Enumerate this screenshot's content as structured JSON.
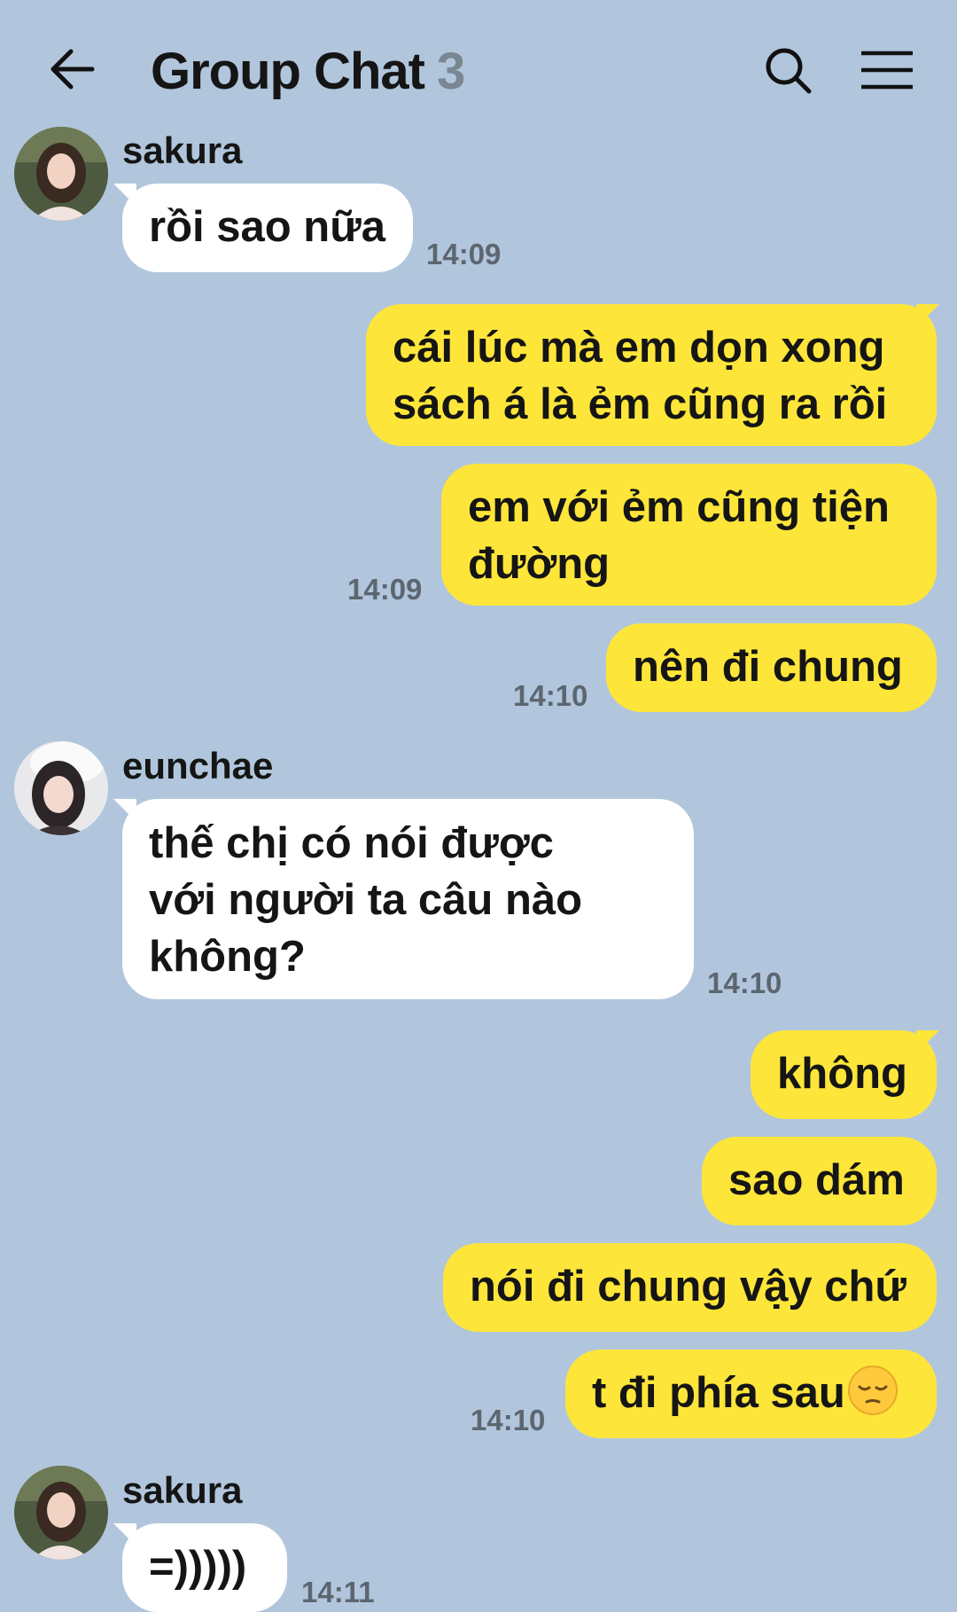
{
  "header": {
    "title": "Group Chat",
    "member_count": "3"
  },
  "messages": [
    {
      "sender": "sakura",
      "text": "rồi sao nữa",
      "time": "14:09"
    },
    {
      "side": "me",
      "lines": [
        "cái lúc mà em dọn xong",
        "sách á là ẻm cũng ra rồi"
      ]
    },
    {
      "side": "me",
      "lines": [
        "em với ẻm cũng tiện",
        "đường"
      ],
      "time": "14:09"
    },
    {
      "side": "me",
      "text": "nên đi chung",
      "time": "14:10"
    },
    {
      "sender": "eunchae",
      "lines": [
        "thế chị có nói được",
        "với người ta câu nào",
        "không?"
      ],
      "time": "14:10"
    },
    {
      "side": "me",
      "text": "không"
    },
    {
      "side": "me",
      "text": "sao dám"
    },
    {
      "side": "me",
      "text": "nói đi chung vậy chứ"
    },
    {
      "side": "me",
      "text": "t đi phía sau",
      "emoji": "pensive-face",
      "time": "14:10"
    },
    {
      "sender": "sakura",
      "text": "=)))))",
      "time": "14:11"
    }
  ],
  "colors": {
    "background": "#b1c6dc",
    "outgoing_bubble": "#fee53a",
    "incoming_bubble": "#ffffff",
    "timestamp": "#5d6670",
    "member_count": "#7a8691"
  }
}
